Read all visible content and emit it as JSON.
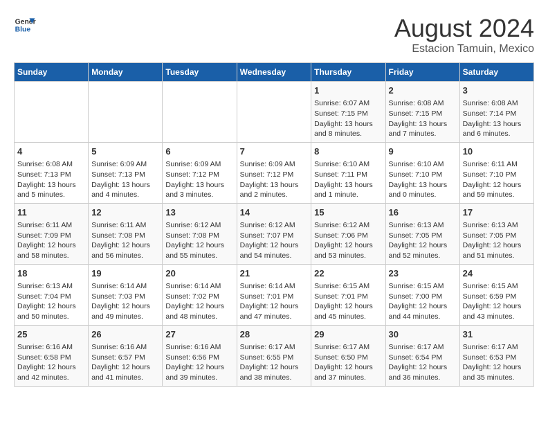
{
  "header": {
    "logo_line1": "General",
    "logo_line2": "Blue",
    "month_year": "August 2024",
    "location": "Estacion Tamuin, Mexico"
  },
  "days_of_week": [
    "Sunday",
    "Monday",
    "Tuesday",
    "Wednesday",
    "Thursday",
    "Friday",
    "Saturday"
  ],
  "weeks": [
    [
      {
        "day": "",
        "content": ""
      },
      {
        "day": "",
        "content": ""
      },
      {
        "day": "",
        "content": ""
      },
      {
        "day": "",
        "content": ""
      },
      {
        "day": "1",
        "content": "Sunrise: 6:07 AM\nSunset: 7:15 PM\nDaylight: 13 hours\nand 8 minutes."
      },
      {
        "day": "2",
        "content": "Sunrise: 6:08 AM\nSunset: 7:15 PM\nDaylight: 13 hours\nand 7 minutes."
      },
      {
        "day": "3",
        "content": "Sunrise: 6:08 AM\nSunset: 7:14 PM\nDaylight: 13 hours\nand 6 minutes."
      }
    ],
    [
      {
        "day": "4",
        "content": "Sunrise: 6:08 AM\nSunset: 7:13 PM\nDaylight: 13 hours\nand 5 minutes."
      },
      {
        "day": "5",
        "content": "Sunrise: 6:09 AM\nSunset: 7:13 PM\nDaylight: 13 hours\nand 4 minutes."
      },
      {
        "day": "6",
        "content": "Sunrise: 6:09 AM\nSunset: 7:12 PM\nDaylight: 13 hours\nand 3 minutes."
      },
      {
        "day": "7",
        "content": "Sunrise: 6:09 AM\nSunset: 7:12 PM\nDaylight: 13 hours\nand 2 minutes."
      },
      {
        "day": "8",
        "content": "Sunrise: 6:10 AM\nSunset: 7:11 PM\nDaylight: 13 hours\nand 1 minute."
      },
      {
        "day": "9",
        "content": "Sunrise: 6:10 AM\nSunset: 7:10 PM\nDaylight: 13 hours\nand 0 minutes."
      },
      {
        "day": "10",
        "content": "Sunrise: 6:11 AM\nSunset: 7:10 PM\nDaylight: 12 hours\nand 59 minutes."
      }
    ],
    [
      {
        "day": "11",
        "content": "Sunrise: 6:11 AM\nSunset: 7:09 PM\nDaylight: 12 hours\nand 58 minutes."
      },
      {
        "day": "12",
        "content": "Sunrise: 6:11 AM\nSunset: 7:08 PM\nDaylight: 12 hours\nand 56 minutes."
      },
      {
        "day": "13",
        "content": "Sunrise: 6:12 AM\nSunset: 7:08 PM\nDaylight: 12 hours\nand 55 minutes."
      },
      {
        "day": "14",
        "content": "Sunrise: 6:12 AM\nSunset: 7:07 PM\nDaylight: 12 hours\nand 54 minutes."
      },
      {
        "day": "15",
        "content": "Sunrise: 6:12 AM\nSunset: 7:06 PM\nDaylight: 12 hours\nand 53 minutes."
      },
      {
        "day": "16",
        "content": "Sunrise: 6:13 AM\nSunset: 7:05 PM\nDaylight: 12 hours\nand 52 minutes."
      },
      {
        "day": "17",
        "content": "Sunrise: 6:13 AM\nSunset: 7:05 PM\nDaylight: 12 hours\nand 51 minutes."
      }
    ],
    [
      {
        "day": "18",
        "content": "Sunrise: 6:13 AM\nSunset: 7:04 PM\nDaylight: 12 hours\nand 50 minutes."
      },
      {
        "day": "19",
        "content": "Sunrise: 6:14 AM\nSunset: 7:03 PM\nDaylight: 12 hours\nand 49 minutes."
      },
      {
        "day": "20",
        "content": "Sunrise: 6:14 AM\nSunset: 7:02 PM\nDaylight: 12 hours\nand 48 minutes."
      },
      {
        "day": "21",
        "content": "Sunrise: 6:14 AM\nSunset: 7:01 PM\nDaylight: 12 hours\nand 47 minutes."
      },
      {
        "day": "22",
        "content": "Sunrise: 6:15 AM\nSunset: 7:01 PM\nDaylight: 12 hours\nand 45 minutes."
      },
      {
        "day": "23",
        "content": "Sunrise: 6:15 AM\nSunset: 7:00 PM\nDaylight: 12 hours\nand 44 minutes."
      },
      {
        "day": "24",
        "content": "Sunrise: 6:15 AM\nSunset: 6:59 PM\nDaylight: 12 hours\nand 43 minutes."
      }
    ],
    [
      {
        "day": "25",
        "content": "Sunrise: 6:16 AM\nSunset: 6:58 PM\nDaylight: 12 hours\nand 42 minutes."
      },
      {
        "day": "26",
        "content": "Sunrise: 6:16 AM\nSunset: 6:57 PM\nDaylight: 12 hours\nand 41 minutes."
      },
      {
        "day": "27",
        "content": "Sunrise: 6:16 AM\nSunset: 6:56 PM\nDaylight: 12 hours\nand 39 minutes."
      },
      {
        "day": "28",
        "content": "Sunrise: 6:17 AM\nSunset: 6:55 PM\nDaylight: 12 hours\nand 38 minutes."
      },
      {
        "day": "29",
        "content": "Sunrise: 6:17 AM\nSunset: 6:50 PM\nDaylight: 12 hours\nand 37 minutes."
      },
      {
        "day": "30",
        "content": "Sunrise: 6:17 AM\nSunset: 6:54 PM\nDaylight: 12 hours\nand 36 minutes."
      },
      {
        "day": "31",
        "content": "Sunrise: 6:17 AM\nSunset: 6:53 PM\nDaylight: 12 hours\nand 35 minutes."
      }
    ]
  ]
}
